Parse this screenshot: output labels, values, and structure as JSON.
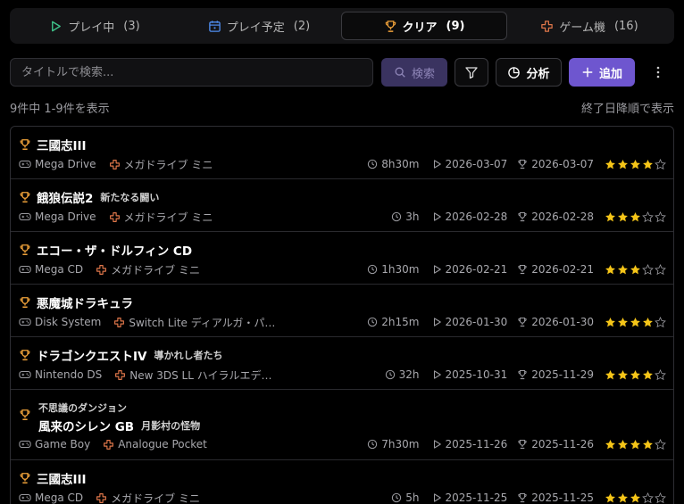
{
  "tabs": [
    {
      "label": "プレイ中",
      "count": "(3)",
      "icon": "play-icon",
      "active": false
    },
    {
      "label": "プレイ予定",
      "count": "(2)",
      "icon": "calendar-icon",
      "active": false
    },
    {
      "label": "クリア",
      "count": "(9)",
      "icon": "trophy-icon",
      "active": true
    },
    {
      "label": "ゲーム機",
      "count": "(16)",
      "icon": "gamepad-icon",
      "active": false
    }
  ],
  "search": {
    "placeholder": "タイトルで検索...",
    "value": "",
    "button_label": "検索"
  },
  "toolbar": {
    "analyze_label": "分析",
    "add_label": "追加"
  },
  "summary": {
    "count_text": "9件中 1-9件を表示",
    "sort_text": "終了日降順で表示"
  },
  "colors": {
    "accent": "#6e56cf",
    "trophy": "#f0a23a",
    "device": "#e0774a",
    "star": "#f5c518"
  },
  "items": [
    {
      "series": "",
      "title": "三國志III",
      "subtitle": "",
      "platform": "Mega Drive",
      "device": "メガドライブ ミニ",
      "duration": "8h30m",
      "start": "2026-03-07",
      "end": "2026-03-07",
      "rating": 4
    },
    {
      "series": "",
      "title": "餓狼伝説2",
      "subtitle": "新たなる闘い",
      "platform": "Mega Drive",
      "device": "メガドライブ ミニ",
      "duration": "3h",
      "start": "2026-02-28",
      "end": "2026-02-28",
      "rating": 3
    },
    {
      "series": "",
      "title": "エコー・ザ・ドルフィン CD",
      "subtitle": "",
      "platform": "Mega CD",
      "device": "メガドライブ ミニ",
      "duration": "1h30m",
      "start": "2026-02-21",
      "end": "2026-02-21",
      "rating": 3
    },
    {
      "series": "",
      "title": "悪魔城ドラキュラ",
      "subtitle": "",
      "platform": "Disk System",
      "device": "Switch Lite ディアルガ・パ…",
      "duration": "2h15m",
      "start": "2026-01-30",
      "end": "2026-01-30",
      "rating": 4
    },
    {
      "series": "",
      "title": "ドラゴンクエストIV",
      "subtitle": "導かれし者たち",
      "platform": "Nintendo DS",
      "device": "New 3DS LL ハイラルエデ…",
      "duration": "32h",
      "start": "2025-10-31",
      "end": "2025-11-29",
      "rating": 4
    },
    {
      "series": "不思議のダンジョン",
      "title": "風来のシレン GB",
      "subtitle": "月影村の怪物",
      "platform": "Game Boy",
      "device": "Analogue Pocket",
      "duration": "7h30m",
      "start": "2025-11-26",
      "end": "2025-11-26",
      "rating": 4
    },
    {
      "series": "",
      "title": "三國志III",
      "subtitle": "",
      "platform": "Mega CD",
      "device": "メガドライブ ミニ",
      "duration": "5h",
      "start": "2025-11-25",
      "end": "2025-11-25",
      "rating": 3
    }
  ]
}
